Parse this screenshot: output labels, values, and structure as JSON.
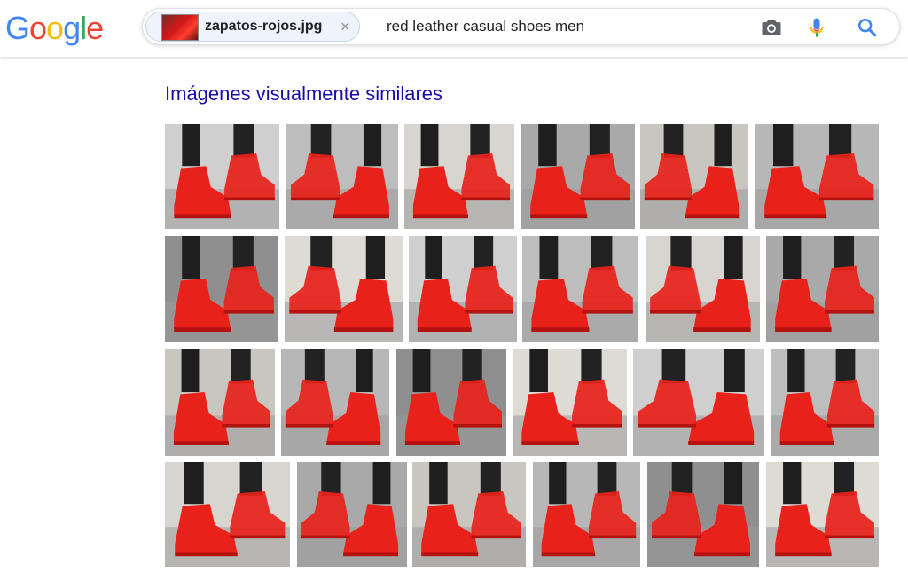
{
  "logo": {
    "letters": [
      "G",
      "o",
      "o",
      "g",
      "l",
      "e"
    ]
  },
  "search": {
    "image_chip_label": "zapatos-rojos.jpg",
    "close_symbol": "×",
    "query": "red leather casual shoes men",
    "icons": [
      "camera-icon",
      "microphone-icon",
      "search-icon"
    ]
  },
  "section_title": "Imágenes visualmente similares",
  "colors": {
    "accent_link": "#1a0dab",
    "shoe_red": "#e8221b",
    "logo_blue": "#4285f4",
    "logo_red": "#ea4335",
    "logo_yellow": "#fbbc05",
    "logo_green": "#34a853"
  },
  "results": {
    "rows": 4,
    "per_row": 6
  }
}
